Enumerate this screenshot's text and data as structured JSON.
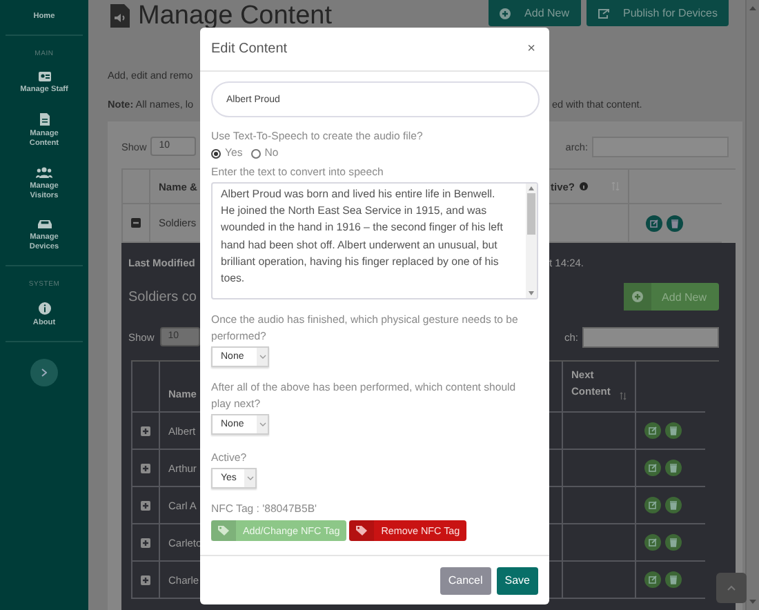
{
  "sidebar": {
    "items": [
      {
        "kind": "link",
        "label": "Home"
      },
      {
        "kind": "heading",
        "label": "MAIN"
      },
      {
        "kind": "link",
        "label": "Manage Staff"
      },
      {
        "kind": "link",
        "label": "Manage Content"
      },
      {
        "kind": "link",
        "label": "Manage Visitors"
      },
      {
        "kind": "link",
        "label": "Manage Devices"
      },
      {
        "kind": "heading",
        "label": "SYSTEM"
      },
      {
        "kind": "link",
        "label": "About"
      }
    ]
  },
  "page": {
    "title": "Manage Content",
    "buttons": [
      {
        "kind": "add",
        "label": "Add New"
      },
      {
        "kind": "publish",
        "label": "Publish for Devices"
      }
    ],
    "intro": "Add, edit and remo",
    "note": "**Note:** All names, lo",
    "note_end": "ed with that content."
  },
  "table": {
    "show_label": "Show",
    "page_size": "10",
    "search_label": "arch:",
    "columns": [
      "Name &",
      "tive?"
    ],
    "rows": [
      {
        "expanded": true,
        "name": "Soldiers"
      }
    ]
  },
  "detail": {
    "last_modified": "Last Modified",
    "time": "t 14:24.",
    "title": "Soldiers co",
    "add_button": "Add New",
    "show_label": "Show",
    "page_size": "10",
    "search_label": "ch:",
    "columns": [
      "Name",
      "Next Content"
    ],
    "rows": [
      {
        "expanded": false,
        "name": "Albert"
      },
      {
        "expanded": false,
        "name": "Arthur"
      },
      {
        "expanded": false,
        "name": "Carl A"
      },
      {
        "expanded": false,
        "name": "Carleto"
      },
      {
        "expanded": false,
        "name": "Charle"
      }
    ]
  },
  "modal": {
    "title": "Edit Content",
    "close": "×",
    "name_value": "Albert Proud",
    "tts_question": "Use Text-To-Speech to create the audio file?",
    "tts_options": [
      {
        "label": "Yes",
        "selected": true
      },
      {
        "label": "No",
        "selected": false
      }
    ],
    "text_label": "Enter the text to convert into speech",
    "text_value": "Albert Proud was born and lived his entire life in Benwell. He joined the North East Sea Service in 1915, and was wounded in the hand in 1916 – the second finger of his left hand had been shot off. Albert underwent an unusual, but brilliant operation, having his finger replaced by one of his toes.",
    "gesture_label": "Once the audio has finished, which physical gesture needs to be performed?",
    "gesture_value": "None",
    "next_label": "After all of the above has been performed, which content should play next?",
    "next_value": "None",
    "active_label": "Active?",
    "active_value": "Yes",
    "nfc_label": "NFC Tag : '88047B5B'",
    "nfc_buttons": [
      {
        "kind": "add",
        "label": "Add/Change NFC Tag"
      },
      {
        "kind": "remove",
        "label": "Remove NFC Tag"
      }
    ],
    "footer_buttons": [
      {
        "kind": "cancel",
        "label": "Cancel"
      },
      {
        "kind": "save",
        "label": "Save"
      }
    ]
  }
}
